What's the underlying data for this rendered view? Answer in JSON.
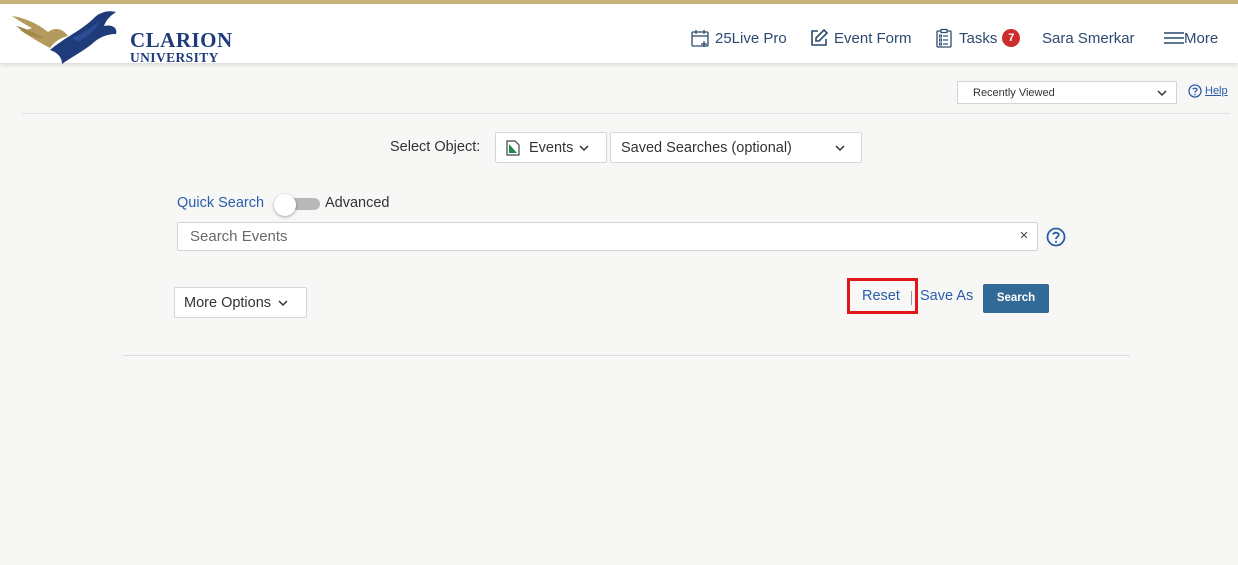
{
  "logo": {
    "line1": "CLARION",
    "line2": "UNIVERSITY"
  },
  "nav": {
    "live_pro": "25Live Pro",
    "event_form": "Event Form",
    "tasks": "Tasks",
    "tasks_count": "7",
    "user": "Sara Smerkar",
    "more": "More"
  },
  "recently_viewed": {
    "selected": "Recently Viewed"
  },
  "help": "Help",
  "select_object": {
    "label": "Select Object:",
    "object": "Events",
    "saved_searches": "Saved Searches (optional)"
  },
  "search_mode": {
    "quick": "Quick Search",
    "advanced": "Advanced"
  },
  "search": {
    "placeholder": "Search Events",
    "value": "",
    "clear": "×"
  },
  "actions": {
    "more_options": "More Options",
    "reset": "Reset",
    "save_as": "Save As",
    "search": "Search"
  },
  "colors": {
    "accent": "#2a5caa",
    "primary_button": "#326a97",
    "badge": "#cc2d2d",
    "highlight": "#e0161b",
    "logo_blue": "#1f3b7a",
    "logo_gold": "#b49a5c"
  }
}
